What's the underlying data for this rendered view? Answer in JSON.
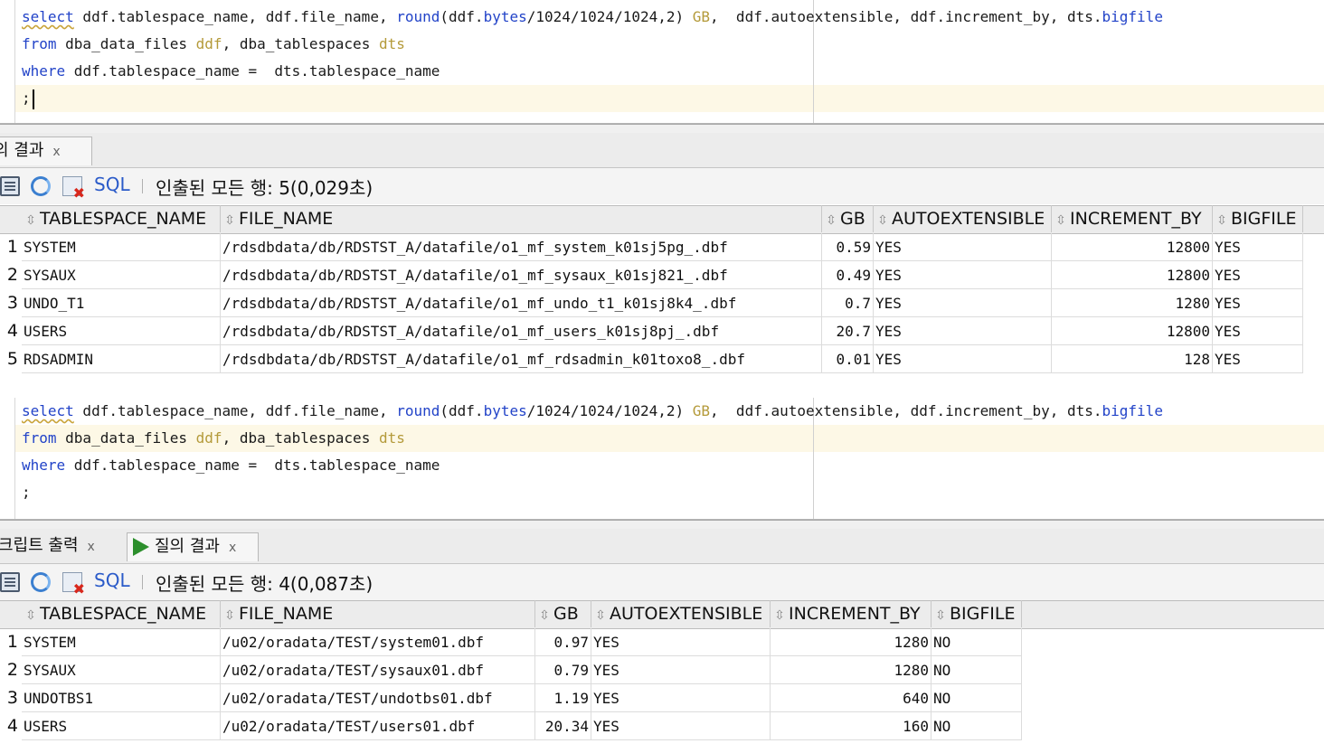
{
  "editor1": {
    "lines": [
      [
        "select",
        " ddf.tablespace_name, ddf.file_name, ",
        "round",
        "(ddf.",
        "bytes",
        "/1024/1024/1024,2) ",
        "GB",
        ",  ddf.autoextensible, ddf.increment_by, dts.",
        "bigfile"
      ],
      [
        "from",
        " dba_data_files ",
        "ddf",
        ", dba_tablespaces ",
        "dts"
      ],
      [
        "where",
        " ddf.tablespace_name =  dts.tablespace_name"
      ],
      [
        ";"
      ]
    ]
  },
  "result1": {
    "tab_label": "의 결과",
    "tab_close": "x",
    "toolbar": {
      "sql_label": "SQL",
      "status": "인출된 모든 행: 5(0,029초)"
    },
    "columns": [
      "TABLESPACE_NAME",
      "FILE_NAME",
      "GB",
      "AUTOEXTENSIBLE",
      "INCREMENT_BY",
      "BIGFILE"
    ],
    "rows": [
      [
        "1",
        "SYSTEM",
        "/rdsdbdata/db/RDSTST_A/datafile/o1_mf_system_k01sj5pg_.dbf",
        "0.59",
        "YES",
        "12800",
        "YES"
      ],
      [
        "2",
        "SYSAUX",
        "/rdsdbdata/db/RDSTST_A/datafile/o1_mf_sysaux_k01sj821_.dbf",
        "0.49",
        "YES",
        "12800",
        "YES"
      ],
      [
        "3",
        "UNDO_T1",
        "/rdsdbdata/db/RDSTST_A/datafile/o1_mf_undo_t1_k01sj8k4_.dbf",
        "0.7",
        "YES",
        "1280",
        "YES"
      ],
      [
        "4",
        "USERS",
        "/rdsdbdata/db/RDSTST_A/datafile/o1_mf_users_k01sj8pj_.dbf",
        "20.7",
        "YES",
        "12800",
        "YES"
      ],
      [
        "5",
        "RDSADMIN",
        "/rdsdbdata/db/RDSTST_A/datafile/o1_mf_rdsadmin_k01toxo8_.dbf",
        "0.01",
        "YES",
        "128",
        "YES"
      ]
    ]
  },
  "editor2": {
    "lines": [
      [
        "select",
        " ddf.tablespace_name, ddf.file_name, ",
        "round",
        "(ddf.",
        "bytes",
        "/1024/1024/1024,2) ",
        "GB",
        ",  ddf.autoextensible, ddf.increment_by, dts.",
        "bigfile"
      ],
      [
        "from",
        " dba_data_files ",
        "ddf",
        ", dba_tablespaces ",
        "dts"
      ],
      [
        "where",
        " ddf.tablespace_name =  dts.tablespace_name"
      ],
      [
        ";"
      ]
    ]
  },
  "result2": {
    "tab_script_label": "크립트 출력",
    "tab_result_label": "질의 결과",
    "tab_close": "x",
    "toolbar": {
      "sql_label": "SQL",
      "status": "인출된 모든 행: 4(0,087초)"
    },
    "columns": [
      "TABLESPACE_NAME",
      "FILE_NAME",
      "GB",
      "AUTOEXTENSIBLE",
      "INCREMENT_BY",
      "BIGFILE"
    ],
    "rows": [
      [
        "1",
        "SYSTEM",
        "/u02/oradata/TEST/system01.dbf",
        "0.97",
        "YES",
        "1280",
        "NO"
      ],
      [
        "2",
        "SYSAUX",
        "/u02/oradata/TEST/sysaux01.dbf",
        "0.79",
        "YES",
        "1280",
        "NO"
      ],
      [
        "3",
        "UNDOTBS1",
        "/u02/oradata/TEST/undotbs01.dbf",
        "1.19",
        "YES",
        "640",
        "NO"
      ],
      [
        "4",
        "USERS",
        "/u02/oradata/TEST/users01.dbf",
        "20.34",
        "YES",
        "160",
        "NO"
      ]
    ]
  }
}
